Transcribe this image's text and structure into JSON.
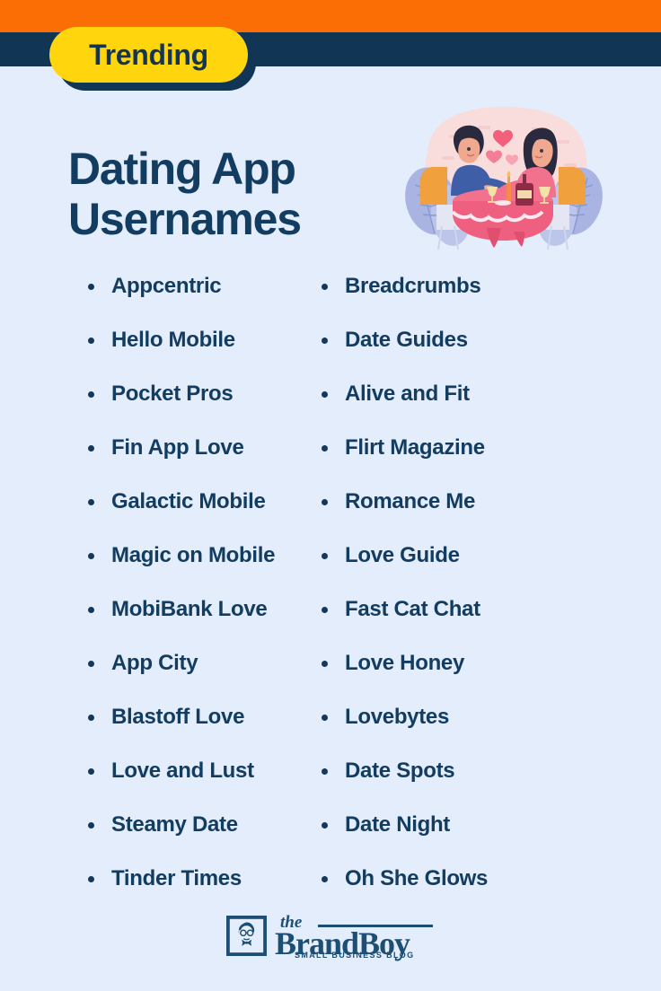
{
  "theme": {
    "band_orange": "#fb6e05",
    "band_navy": "#103555",
    "background": "#e4edfb",
    "badge_yellow": "#ffd60d",
    "text_navy": "#133c61",
    "logo_blue": "#1d4f75"
  },
  "badge": {
    "label": "Trending"
  },
  "title": {
    "line1": "Dating App",
    "line2": "Usernames"
  },
  "illustration": {
    "name": "couple-romantic-dinner-illustration",
    "description": "Man and woman at a round pink dinner table with wine bottle, glasses, candle and floating hearts, framed by blue fern leaves on a pink blob background"
  },
  "lists": {
    "left": [
      "Appcentric",
      "Hello Mobile",
      "Pocket Pros",
      "Fin App Love",
      "Galactic Mobile",
      "Magic on Mobile",
      "MobiBank Love",
      "App City",
      "Blastoff Love",
      "Love and Lust",
      "Steamy Date",
      "Tinder Times"
    ],
    "right": [
      "Breadcrumbs",
      "Date Guides",
      "Alive and Fit",
      "Flirt Magazine",
      "Romance Me",
      "Love Guide",
      "Fast Cat Chat",
      "Love Honey",
      "Lovebytes",
      "Date Spots",
      "Date Night",
      "Oh She Glows"
    ]
  },
  "footer": {
    "logo_the": "the",
    "logo_brand": "BrandBoy",
    "logo_tagline": "SMALL BUSINESS BLOG",
    "logo_mark_name": "brandboy-boy-face-icon"
  }
}
